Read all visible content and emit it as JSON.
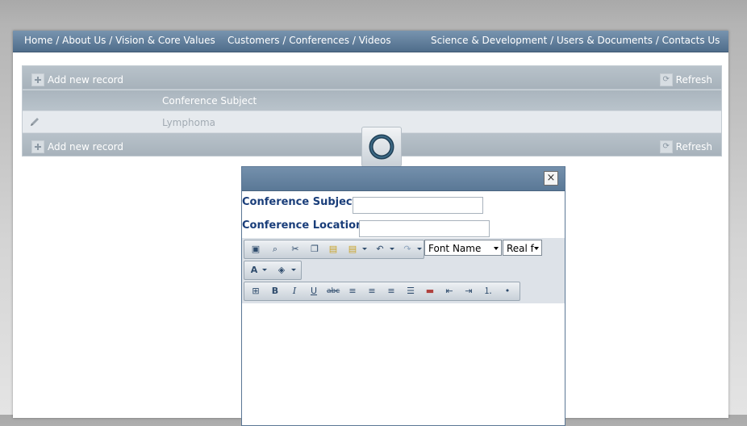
{
  "nav": {
    "link1": "Home / About Us / Vision & Core Values",
    "link2": "Customers / Conferences / Videos",
    "link3": "Science & Development / Users & Documents / Contacts Us"
  },
  "grid": {
    "add_label": "Add new record",
    "refresh_label": "Refresh",
    "column_header": "Conference Subject",
    "rows": [
      {
        "subject": "Lymphoma"
      }
    ]
  },
  "dialog": {
    "close_glyph": "×",
    "subject_label": "Conference Subject:",
    "subject_value": "",
    "location_label": "Conference Location:",
    "location_value": "",
    "font_name_select": "Font Name",
    "font_size_select": "Real f⁠",
    "toolbar_icons": [
      "save-icon",
      "find-replace-icon",
      "cut-icon",
      "copy-icon",
      "paste-icon",
      "paste-options-icon",
      "undo-icon",
      "redo-icon",
      "foreground-color-icon",
      "background-color-icon",
      "select-all-icon",
      "bold-icon",
      "italic-icon",
      "underline-icon",
      "strikethrough-icon",
      "align-left-icon",
      "align-center-icon",
      "align-right-icon",
      "justify-icon",
      "horizontal-rule-icon",
      "outdent-icon",
      "indent-icon",
      "ordered-list-icon",
      "unordered-list-icon"
    ]
  },
  "colors": {
    "nav_bg": "#5b7997",
    "grid_header": "#b9c3cb",
    "label_blue": "#1a3e7a"
  }
}
